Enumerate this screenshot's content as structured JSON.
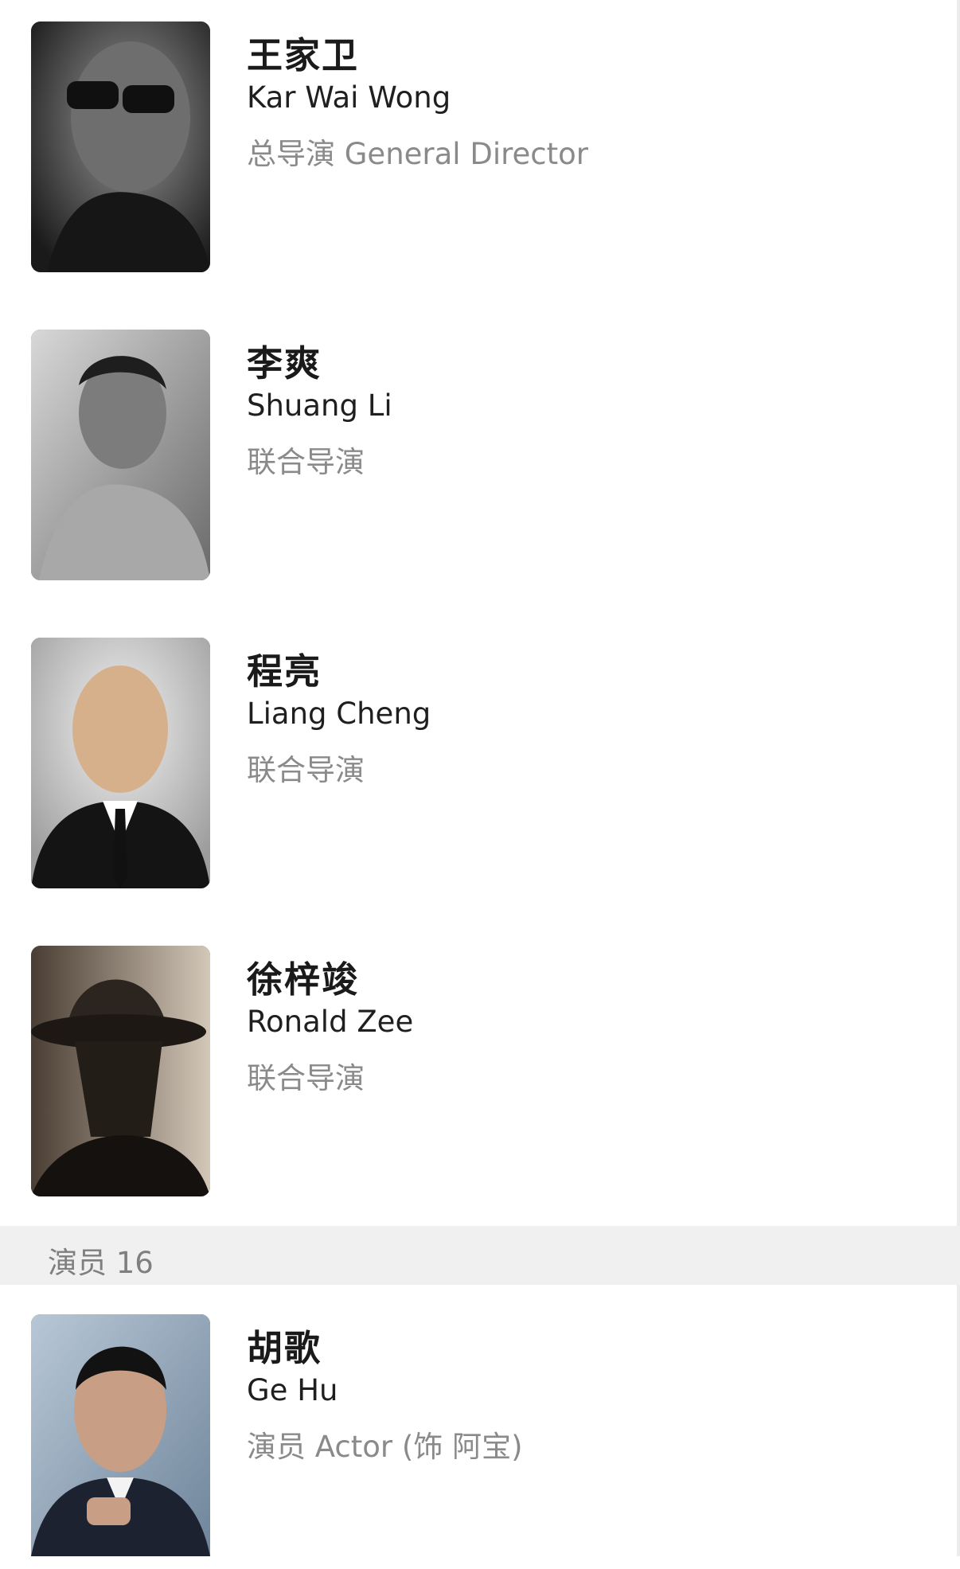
{
  "crew": [
    {
      "name_zh": "王家卫",
      "name_en": "Kar Wai Wong",
      "role": "总导演 General Director",
      "photo": "portrait-with-sunglasses"
    },
    {
      "name_zh": "李爽",
      "name_en": "Shuang Li",
      "role": "联合导演",
      "photo": "portrait-hoodie"
    },
    {
      "name_zh": "程亮",
      "name_en": "Liang Cheng",
      "role": "联合导演",
      "photo": "portrait-suit"
    },
    {
      "name_zh": "徐梓竣",
      "name_en": "Ronald Zee",
      "role": "联合导演",
      "photo": "portrait-hat"
    }
  ],
  "cast_section": {
    "label": "演员 16"
  },
  "cast": [
    {
      "name_zh": "胡歌",
      "name_en": "Ge Hu",
      "role": "演员 Actor (饰 阿宝)",
      "photo": "portrait-actor"
    }
  ]
}
